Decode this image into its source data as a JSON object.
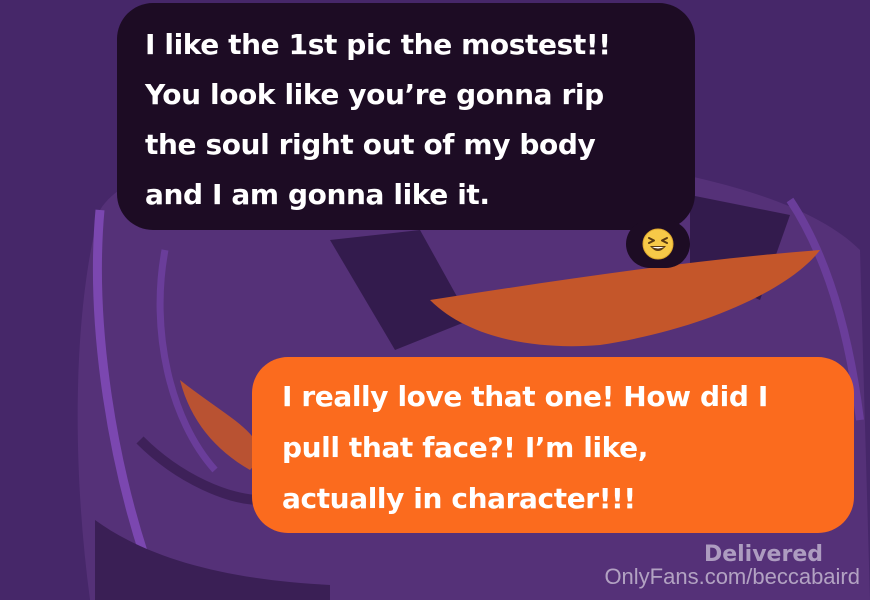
{
  "conversation": {
    "incoming_message": {
      "text": "I like the 1st pic the mostest!!\nYou look like you’re gonna rip\nthe soul right out of my body\nand I am gonna like it.",
      "reaction": "laughing-squinting-emoji"
    },
    "outgoing_message": {
      "text": "I really love that one! How did I\npull that face?! I’m like,\nactually in character!!!"
    },
    "status": "Delivered"
  },
  "watermark": "OnlyFans.com/beccabaird",
  "colors": {
    "wallpaper": "#4a2a6e",
    "incoming_bubble": "#1d0c24",
    "outgoing_bubble": "#fb6b1e",
    "wallpaper_accent_orange": "#c4562a",
    "wallpaper_accent_purple": "#6a3d9a"
  }
}
